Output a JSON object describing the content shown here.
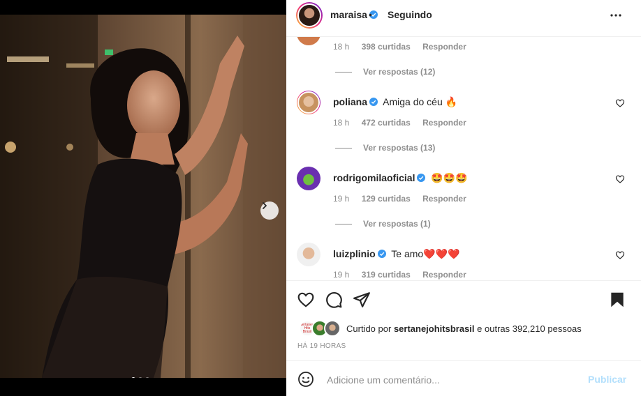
{
  "post": {
    "username": "maraisa",
    "separator": "•",
    "follow_state": "Seguindo",
    "carousel": {
      "slide_count": 3,
      "active_index": 0
    }
  },
  "comments": [
    {
      "time": "18 h",
      "likes": "398 curtidas",
      "reply": "Responder",
      "view_replies": "Ver respostas (12)"
    },
    {
      "username": "poliana",
      "text": "Amiga do céu 🔥",
      "time": "18 h",
      "likes": "472 curtidas",
      "reply": "Responder",
      "view_replies": "Ver respostas (13)"
    },
    {
      "username": "rodrigomilaoficial",
      "text": "🤩🤩🤩",
      "time": "19 h",
      "likes": "129 curtidas",
      "reply": "Responder",
      "view_replies": "Ver respostas (1)"
    },
    {
      "username": "luizplinio",
      "text": "Te amo❤️❤️❤️",
      "time": "19 h",
      "likes": "319 curtidas",
      "reply": "Responder"
    }
  ],
  "likes": {
    "prefix": "Curtido por",
    "user": "sertanejohitsbrasil",
    "suffix": "e outras 392,210 pessoas",
    "avatar_label": "Sertanejo Hits Brasil"
  },
  "timestamp": "HÁ 19 HORAS",
  "add_comment": {
    "placeholder": "Adicione um comentário...",
    "publish_label": "Publicar"
  },
  "icons": [
    "verified-icon",
    "more-icon",
    "heart-icon",
    "comment-icon",
    "share-icon",
    "bookmark-icon",
    "emoji-icon",
    "chevron-right-icon"
  ],
  "colors": {
    "verified": "#3897f0",
    "publish_disabled": "#b2dffc",
    "muted": "#8e8e8e"
  }
}
